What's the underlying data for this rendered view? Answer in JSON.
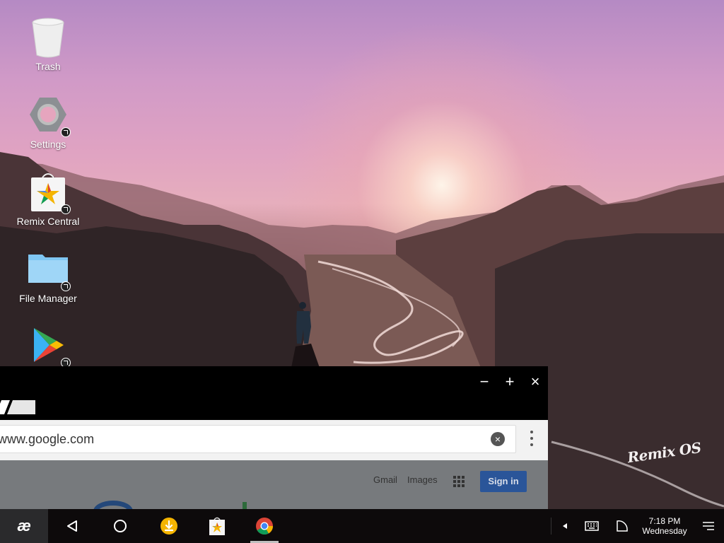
{
  "desktop": {
    "icons": [
      {
        "label": "Trash",
        "icon": "trash-icon"
      },
      {
        "label": "Settings",
        "icon": "settings-icon"
      },
      {
        "label": "Remix Central",
        "icon": "remix-central-icon"
      },
      {
        "label": "File Manager",
        "icon": "folder-icon"
      },
      {
        "label": "",
        "icon": "play-store-icon"
      }
    ],
    "watermark": "Remix OS"
  },
  "browser": {
    "window_controls": {
      "minimize": "−",
      "maximize": "+",
      "close": "×"
    },
    "url": "www.google.com",
    "clear_symbol": "×",
    "page": {
      "gmail": "Gmail",
      "images": "Images",
      "sign_in": "Sign in"
    }
  },
  "taskbar": {
    "start_label": "æ",
    "pinned": [
      "back-icon",
      "home-icon",
      "downloads-icon",
      "remix-central-icon",
      "chrome-icon"
    ],
    "tray": [
      "expand-tray-icon",
      "keyboard-icon",
      "signal-icon",
      "notifications-icon"
    ],
    "clock": {
      "time": "7:18 PM",
      "day": "Wednesday"
    }
  },
  "colors": {
    "taskbar_bg": "#0d0a0b",
    "start_bg": "#2a2a2c",
    "download_orange": "#f4b400",
    "signin_blue": "#2a5599",
    "folder_blue": "#7fc6f2"
  }
}
